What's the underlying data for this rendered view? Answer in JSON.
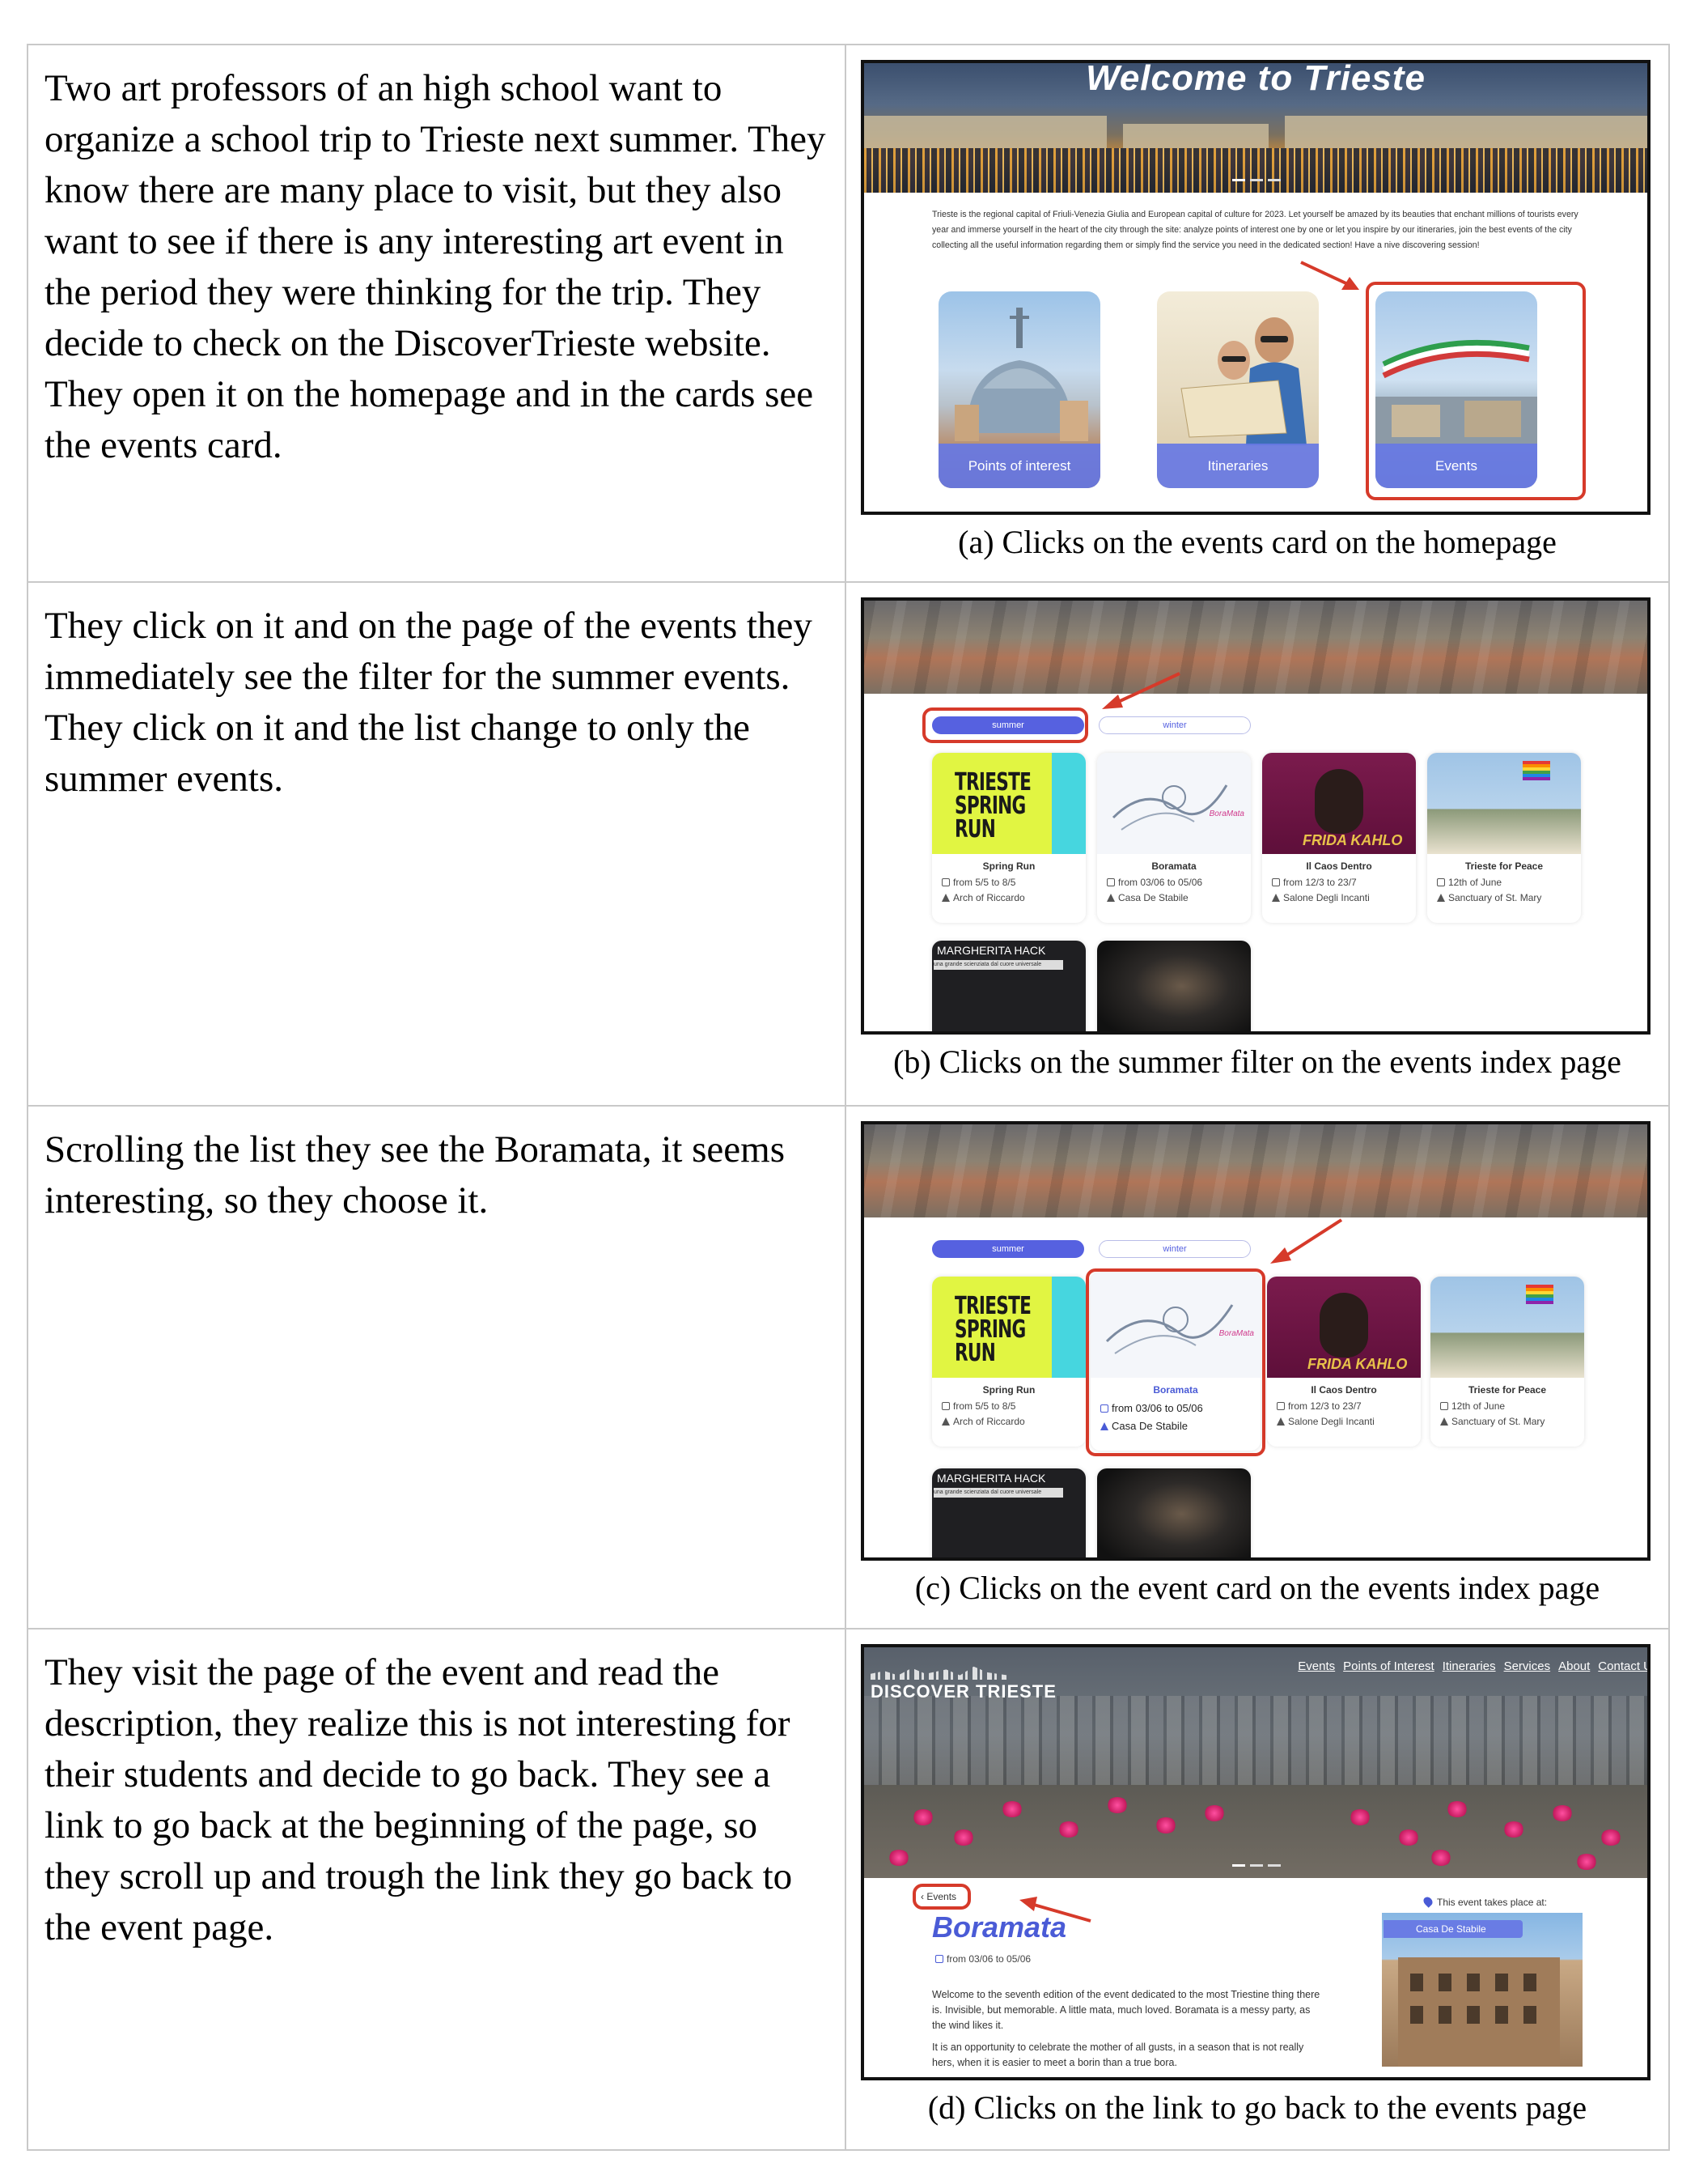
{
  "rows": [
    {
      "story": "Two art professors of an high school want to organize a school trip to Trieste next summer. They know there are many place to visit, but they also want to see if there is any interesting art event in the period they were thinking for the trip. They decide to check on the DiscoverTrieste website. They open it on the homepage and in the cards see the events card.",
      "caption": "(a) Clicks on the events card on the homepage"
    },
    {
      "story": "They click on it and on the page of the events they immediately see the filter for the summer events. They click on it and the list change to only the summer events.",
      "caption": "(b) Clicks on the summer filter on the events index page"
    },
    {
      "story": "Scrolling the list they see the Boramata, it seems interesting, so they choose it.",
      "caption": "(c) Clicks on the event card on the events index page"
    },
    {
      "story": "They visit the page of the event and read the description, they realize this is not interesting for their students and decide to go back. They see a link to go back at the beginning of the page, so they scroll up and trough the link they go back to the event page.",
      "caption": "(d) Clicks on the link to go back to the events page"
    }
  ],
  "homepage": {
    "hero_title": "Welcome to Trieste",
    "intro": "Trieste is the regional capital of Friuli-Venezia Giulia and European capital of culture for 2023. Let yourself be amazed by its beauties that enchant millions of tourists every year and immerse yourself in the heart of the city through the site: analyze points of interest one by one or let you inspire by our itineraries, join the best events of the city collecting all the useful information regarding them or simply find the service you need in the dedicated section! Have a nive discovering session!",
    "cards": [
      "Points of interest",
      "Itineraries",
      "Events"
    ]
  },
  "events_index": {
    "filters": [
      "summer",
      "winter"
    ],
    "events": [
      {
        "title": "Spring Run",
        "date": "from 5/5 to 8/5",
        "place": "Arch of Riccardo",
        "poster": "TRIESTE SPRING RUN"
      },
      {
        "title": "Boramata",
        "date": "from 03/06 to 05/06",
        "place": "Casa De Stabile",
        "poster": "BoraMata"
      },
      {
        "title": "Il Caos Dentro",
        "date": "from 12/3 to 23/7",
        "place": "Salone Degli Incanti",
        "poster": "FRIDA KAHLO"
      },
      {
        "title": "Trieste for Peace",
        "date": "12th of June",
        "place": "Sanctuary of St. Mary",
        "poster": ""
      },
      {
        "title": "",
        "date": "",
        "place": "",
        "poster": "MARGHERITA HACK",
        "poster_sub": "una grande scienziata dal cuore universale"
      },
      {
        "title": "",
        "date": "",
        "place": "",
        "poster": ""
      }
    ]
  },
  "event_page": {
    "brand": "DISCOVER TRIESTE",
    "nav": [
      "Events",
      "Points of Interest",
      "Itineraries",
      "Services",
      "About",
      "Contact U"
    ],
    "back_link": "Events",
    "title": "Boramata",
    "date": "from 03/06 to 05/06",
    "description": [
      "Welcome to the seventh edition of the event dedicated to the most Triestine thing there is. Invisible, but memorable. A little mata, much loved. Boramata is a messy party, as the wind likes it.",
      "It is an opportunity to celebrate the mother of all gusts, in a season that is not really hers, when it is easier to meet a borin than a true bora."
    ],
    "place_label": "This event takes place at:",
    "place_name": "Casa De Stabile"
  },
  "colors": {
    "accent": "#5661e0",
    "highlight": "#d63a2a",
    "border": "#c9c9c9"
  }
}
